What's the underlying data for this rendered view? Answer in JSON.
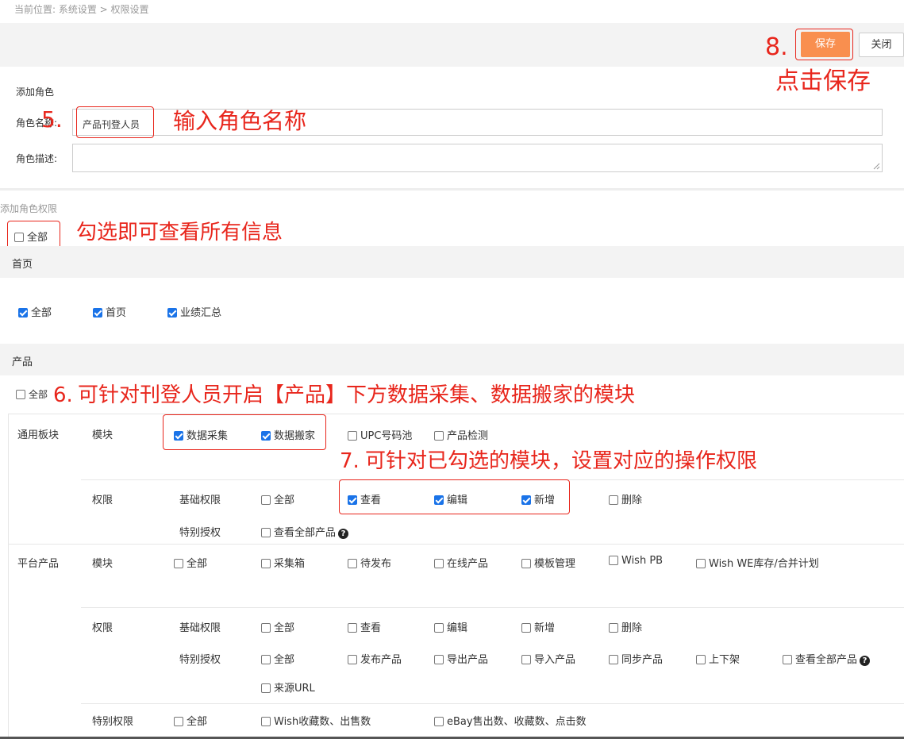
{
  "breadcrumb": "当前位置:  系统设置 > 权限设置",
  "toolbar": {
    "save_label": "保存",
    "close_label": "关闭"
  },
  "role_form": {
    "section_title": "添加角色",
    "name_label": "角色名称:",
    "name_value": "产品刊登人员",
    "desc_label": "角色描述:",
    "desc_value": ""
  },
  "permissions": {
    "section_title": "添加角色权限",
    "all_label": "全部",
    "all_checked": false
  },
  "home": {
    "title": "首页",
    "options": [
      {
        "label": "全部",
        "checked": true
      },
      {
        "label": "首页",
        "checked": true
      },
      {
        "label": "业绩汇总",
        "checked": true
      }
    ]
  },
  "product": {
    "title": "产品",
    "all_label": "全部",
    "all_checked": false,
    "general": {
      "group": "通用板块",
      "module_label": "模块",
      "modules": [
        {
          "label": "数据采集",
          "checked": true
        },
        {
          "label": "数据搬家",
          "checked": true
        },
        {
          "label": "UPC号码池",
          "checked": false
        },
        {
          "label": "产品检测",
          "checked": false
        }
      ],
      "perm_label": "权限",
      "basic_label": "基础权限",
      "basic": [
        {
          "label": "全部",
          "checked": false
        },
        {
          "label": "查看",
          "checked": true
        },
        {
          "label": "编辑",
          "checked": true
        },
        {
          "label": "新增",
          "checked": true
        },
        {
          "label": "删除",
          "checked": false
        }
      ],
      "special_label": "特别授权",
      "special": [
        {
          "label": "查看全部产品",
          "checked": false
        }
      ]
    },
    "platform": {
      "group": "平台产品",
      "module_label": "模块",
      "modules": [
        {
          "label": "全部",
          "checked": false
        },
        {
          "label": "采集箱",
          "checked": false
        },
        {
          "label": "待发布",
          "checked": false
        },
        {
          "label": "在线产品",
          "checked": false
        },
        {
          "label": "模板管理",
          "checked": false
        },
        {
          "label": "Wish PB",
          "checked": false
        },
        {
          "label": "Wish WE库存/合并计划",
          "checked": false
        }
      ],
      "perm_label": "权限",
      "basic_label": "基础权限",
      "basic": [
        {
          "label": "全部",
          "checked": false
        },
        {
          "label": "查看",
          "checked": false
        },
        {
          "label": "编辑",
          "checked": false
        },
        {
          "label": "新增",
          "checked": false
        },
        {
          "label": "删除",
          "checked": false
        }
      ],
      "special_label": "特别授权",
      "special": [
        {
          "label": "全部",
          "checked": false
        },
        {
          "label": "发布产品",
          "checked": false
        },
        {
          "label": "导出产品",
          "checked": false
        },
        {
          "label": "导入产品",
          "checked": false
        },
        {
          "label": "同步产品",
          "checked": false
        },
        {
          "label": "上下架",
          "checked": false
        },
        {
          "label": "查看全部产品",
          "checked": false
        },
        {
          "label": "来源URL",
          "checked": false
        }
      ],
      "special_perm_label": "特别权限",
      "special_perm": [
        {
          "label": "全部",
          "checked": false
        },
        {
          "label": "Wish收藏数、出售数",
          "checked": false
        },
        {
          "label": "eBay售出数、收藏数、点击数",
          "checked": false
        }
      ]
    }
  },
  "help_icon_glyph": "?",
  "annotations": {
    "step5_num": "5.",
    "step5_text": "输入角色名称",
    "step_all_text": "勾选即可查看所有信息",
    "step6_num": "6.",
    "step6_text": "可针对刊登人员开启【产品】下方数据采集、数据搬家的模块",
    "step7_num": "7.",
    "step7_text": "可针对已勾选的模块，设置对应的操作权限",
    "step8_num": "8.",
    "step8_text": "点击保存",
    "color": "#e8261c"
  },
  "colors": {
    "accent_orange": "#f98f4f",
    "checkbox_blue": "#1a73e8",
    "annotation_red": "#e8261c",
    "band_gray": "#f3f3f3"
  }
}
